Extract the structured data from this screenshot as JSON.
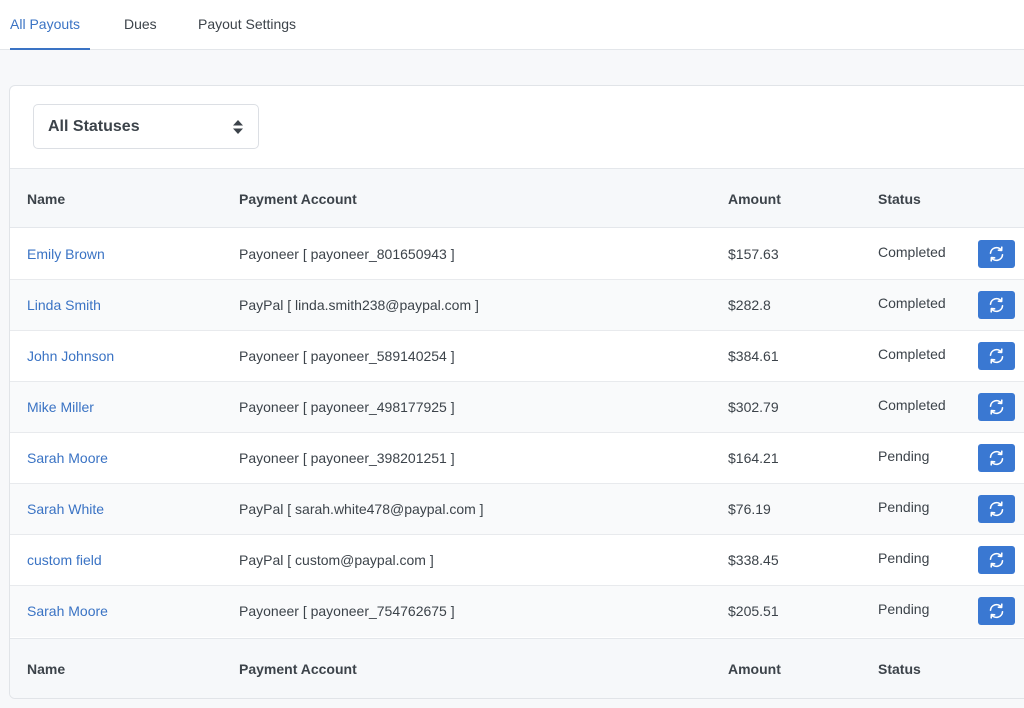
{
  "tabs": [
    {
      "label": "All Payouts",
      "active": true
    },
    {
      "label": "Dues",
      "active": false
    },
    {
      "label": "Payout Settings",
      "active": false
    }
  ],
  "filter": {
    "selected": "All Statuses",
    "icon": "sort-icon"
  },
  "table": {
    "headers": {
      "name": "Name",
      "account": "Payment Account",
      "amount": "Amount",
      "status": "Status"
    },
    "rows": [
      {
        "name": "Emily Brown",
        "account": "Payoneer [ payoneer_801650943 ]",
        "amount": "$157.63",
        "status": "Completed"
      },
      {
        "name": "Linda Smith",
        "account": "PayPal [ linda.smith238@paypal.com ]",
        "amount": "$282.8",
        "status": "Completed"
      },
      {
        "name": "John Johnson",
        "account": "Payoneer [ payoneer_589140254 ]",
        "amount": "$384.61",
        "status": "Completed"
      },
      {
        "name": "Mike Miller",
        "account": "Payoneer [ payoneer_498177925 ]",
        "amount": "$302.79",
        "status": "Completed"
      },
      {
        "name": "Sarah Moore",
        "account": "Payoneer [ payoneer_398201251 ]",
        "amount": "$164.21",
        "status": "Pending"
      },
      {
        "name": "Sarah White",
        "account": "PayPal [ sarah.white478@paypal.com ]",
        "amount": "$76.19",
        "status": "Pending"
      },
      {
        "name": "custom field",
        "account": "PayPal [ custom@paypal.com ]",
        "amount": "$338.45",
        "status": "Pending"
      },
      {
        "name": "Sarah Moore",
        "account": "Payoneer [ payoneer_754762675 ]",
        "amount": "$205.51",
        "status": "Pending"
      }
    ],
    "action_icon": "refresh-icon"
  },
  "colors": {
    "accent": "#3a73c4",
    "button": "#3a78d2"
  }
}
